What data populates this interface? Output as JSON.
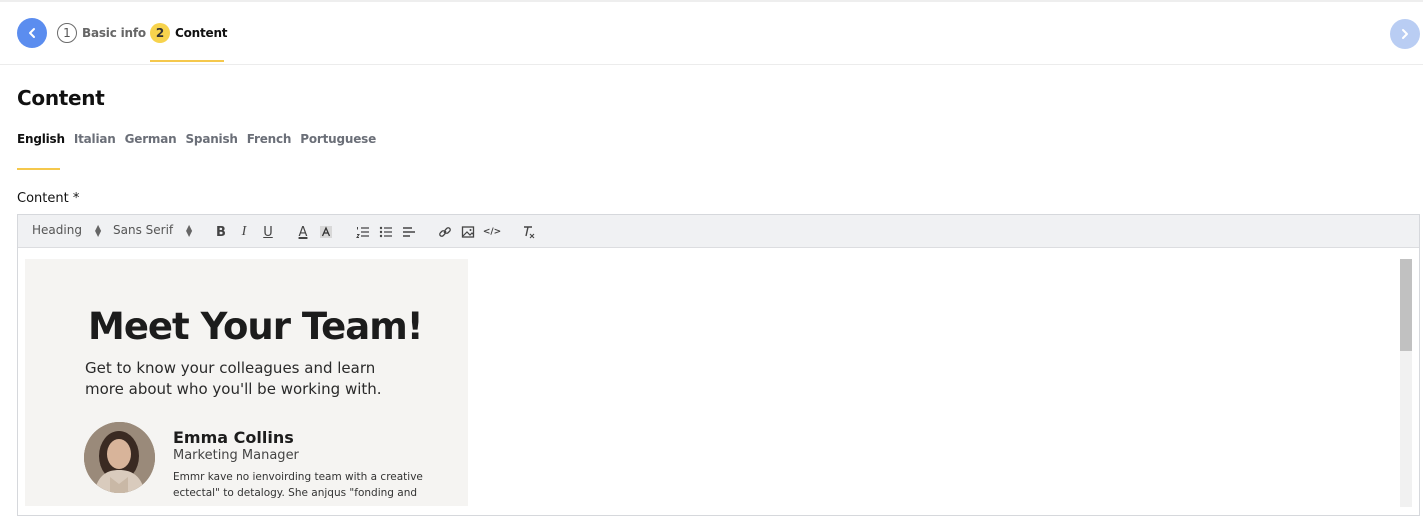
{
  "stepper": {
    "steps": [
      {
        "number": "1",
        "label": "Basic info"
      },
      {
        "number": "2",
        "label": "Content"
      }
    ],
    "active_step": 2,
    "colors": {
      "back_button": "#5b8def",
      "next_button": "#b9cdf3",
      "accent": "#f5c84c"
    }
  },
  "page": {
    "title": "Content"
  },
  "languages": {
    "tabs": [
      "English",
      "Italian",
      "German",
      "Spanish",
      "French",
      "Portuguese"
    ],
    "active": "English"
  },
  "field": {
    "label": "Content *"
  },
  "toolbar": {
    "heading_select": "Heading",
    "font_select": "Sans Serif",
    "buttons": [
      "bold-icon",
      "italic-icon",
      "underline-icon",
      "text-color-icon",
      "highlight-icon",
      "ordered-list-icon",
      "bullet-list-icon",
      "align-icon",
      "link-icon",
      "image-icon",
      "code-icon",
      "clear-format-icon"
    ],
    "bold": "B",
    "italic": "I",
    "underline": "U",
    "color": "A",
    "code": "</>"
  },
  "embedded_image": {
    "title": "Meet Your Team!",
    "subtitle": "Get to know your colleagues and learn more about who you'll be working with.",
    "member": {
      "name": "Emma Collins",
      "role": "Marketing Manager",
      "bio": "Emmr kave no ienvoirding team with a creative ectectal\" to detalogy. She anjqus \"fonding and"
    }
  }
}
